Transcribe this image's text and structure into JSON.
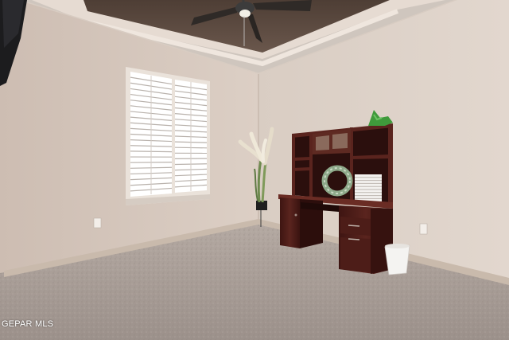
{
  "watermark": {
    "text": "GEPAR MLS"
  },
  "scene": {
    "wall_color": "#d8cbc1",
    "ceiling_color": "#5c4a40",
    "carpet_color": "#a69a93",
    "desk_color": "#4a1c18",
    "trim_color": "#c7b8aa",
    "shutter_color": "#ffffff"
  }
}
